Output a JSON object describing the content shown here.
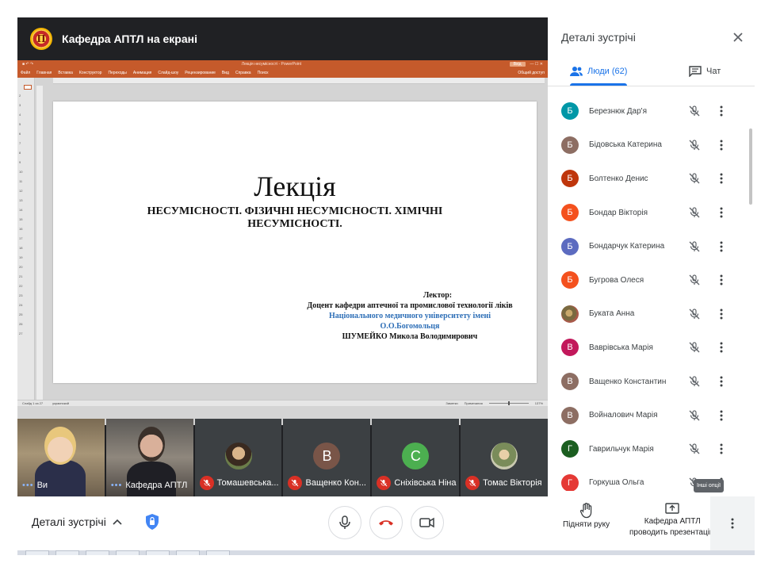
{
  "stage": {
    "presenter_title": "Кафедра АПТЛ на екрані",
    "logo_letter": "П"
  },
  "ppt": {
    "doc_title": "Лекція несумісності - PowerPoint",
    "signin": "Вхід",
    "menu": [
      "Файл",
      "Главная",
      "Вставка",
      "Конструктор",
      "Переходы",
      "Анимация",
      "Слайд-шоу",
      "Рецензирование",
      "Вид",
      "Справка",
      "Поиск"
    ],
    "share": "Общий доступ",
    "status_left": "Слайд 1 из 27",
    "status_lang": "украинский",
    "status_notes": "Заметки",
    "status_comments": "Примечания",
    "zoom": "137%",
    "slide": {
      "heading": "Лекція",
      "subtitle": "НЕСУМІСНОСТІ. ФІЗИЧНІ НЕСУМІСНОСТІ. ХІМІЧНІ НЕСУМІСНОСТІ.",
      "lecturer_label": "Лектор:",
      "lecturer_line2": "Доцент кафедри аптечної та промислової технології ліків",
      "lecturer_line3": "Національного медичного університету імені",
      "lecturer_line4": "О.О.Богомольця",
      "lecturer_line5": "ШУМЕЙКО Микола Володимирович"
    }
  },
  "tiles": [
    {
      "label": "Ви",
      "kind": "video",
      "muted": false
    },
    {
      "label": "Кафедра АПТЛ",
      "kind": "video",
      "muted": false
    },
    {
      "label": "Томашевська...",
      "kind": "photo",
      "muted": true
    },
    {
      "label": "Ващенко Кон...",
      "kind": "letter",
      "letter": "В",
      "color": "#795548",
      "muted": true
    },
    {
      "label": "Сніхівська Ніна",
      "kind": "letter",
      "letter": "С",
      "color": "#4caf50",
      "muted": true
    },
    {
      "label": "Томас Вікторія",
      "kind": "photo",
      "muted": true
    }
  ],
  "controls": {
    "details_label": "Деталі зустрічі",
    "raise_hand_label": "Підняти руку",
    "presenting_line1": "Кафедра АПТЛ",
    "presenting_line2": "проводить презентацію",
    "tooltip": "Інші опції"
  },
  "panel": {
    "title": "Деталі зустрічі",
    "tab_people": "Люди (62)",
    "tab_chat": "Чат",
    "people": [
      {
        "letter": "Б",
        "name": "Березнюк Дар'я",
        "color": "#0097a7"
      },
      {
        "letter": "Б",
        "name": "Бідовська Катерина",
        "color": "#8d6e63"
      },
      {
        "letter": "Б",
        "name": "Болтенко Денис",
        "color": "#bf360c"
      },
      {
        "letter": "Б",
        "name": "Бондар Вікторія",
        "color": "#f4511e"
      },
      {
        "letter": "Б",
        "name": "Бондарчук Катерина",
        "color": "#5c6bc0"
      },
      {
        "letter": "Б",
        "name": "Бугрова Олеся",
        "color": "#f4511e"
      },
      {
        "letter": "",
        "name": "Буката Анна",
        "color": "#8a7a5a"
      },
      {
        "letter": "В",
        "name": "Ваврівська Марія",
        "color": "#c2185b"
      },
      {
        "letter": "В",
        "name": "Ващенко Константин",
        "color": "#8d6e63"
      },
      {
        "letter": "В",
        "name": "Войналович Марія",
        "color": "#8d6e63"
      },
      {
        "letter": "Г",
        "name": "Гаврильчук Марія",
        "color": "#1b5e20"
      },
      {
        "letter": "Г",
        "name": "Горкуша Ольга",
        "color": "#e53935"
      }
    ]
  },
  "colors": {
    "accent": "#1a73e8",
    "ppt_orange": "#c55a2b",
    "hangup": "#d93025"
  }
}
